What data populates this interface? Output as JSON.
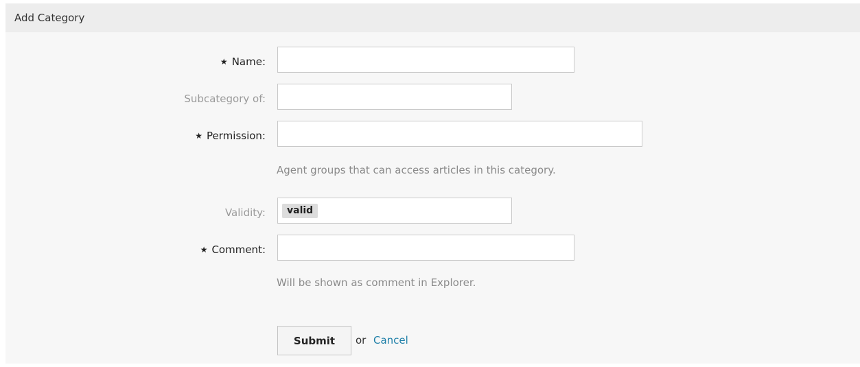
{
  "panel": {
    "title": "Add Category"
  },
  "form": {
    "name": {
      "label": "Name:",
      "required_marker": "★",
      "value": ""
    },
    "subcategory": {
      "label": "Subcategory of:",
      "value": ""
    },
    "permission": {
      "label": "Permission:",
      "required_marker": "★",
      "value": "",
      "hint": "Agent groups that can access articles in this category."
    },
    "validity": {
      "label": "Validity:",
      "selected": "valid"
    },
    "comment": {
      "label": "Comment:",
      "required_marker": "★",
      "value": "",
      "hint": "Will be shown as comment in Explorer."
    }
  },
  "actions": {
    "submit_label": "Submit",
    "or_text": "or",
    "cancel_label": "Cancel"
  },
  "colors": {
    "link": "#1e7fa8",
    "optional_label": "#9a9a9a",
    "hint": "#8a8a8a"
  }
}
